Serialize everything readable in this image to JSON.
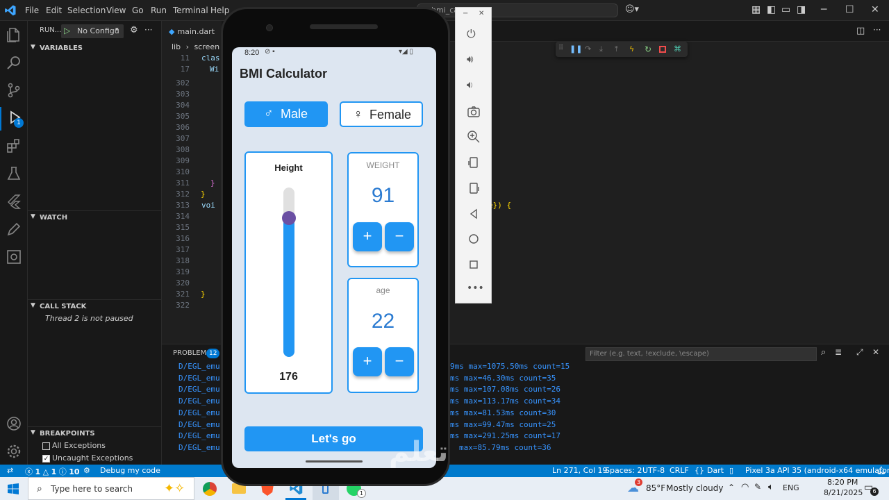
{
  "titlebar": {
    "menus": [
      "File",
      "Edit",
      "Selection",
      "View",
      "Go",
      "Run",
      "Terminal",
      "Help"
    ],
    "search_text": "bmi_ca"
  },
  "sidebar": {
    "run_label": "RUN...",
    "config_label": "No Configu",
    "variables_header": "VARIABLES",
    "watch_header": "WATCH",
    "callstack_header": "CALL STACK",
    "callstack_text": "Thread 2 is not paused",
    "breakpoints_header": "BREAKPOINTS",
    "breakpoints": [
      {
        "label": "All Exceptions",
        "checked": false
      },
      {
        "label": "Uncaught Exceptions",
        "checked": true
      }
    ]
  },
  "editor": {
    "tab_label": "main.dart",
    "breadcrumb": [
      "lib",
      "screen"
    ],
    "lines": [
      {
        "n": "11",
        "code": "clas"
      },
      {
        "n": "17",
        "code": "Wi"
      },
      {
        "n": "302",
        "code": ""
      },
      {
        "n": "303",
        "code": ""
      },
      {
        "n": "304",
        "code": ""
      },
      {
        "n": "305",
        "code": ""
      },
      {
        "n": "306",
        "code": ""
      },
      {
        "n": "307",
        "code": ""
      },
      {
        "n": "308",
        "code": ""
      },
      {
        "n": "309",
        "code": ""
      },
      {
        "n": "310",
        "code": ""
      },
      {
        "n": "311",
        "code": "}"
      },
      {
        "n": "312",
        "code": "}"
      },
      {
        "n": "313",
        "code": "voi"
      },
      {
        "n": "314",
        "code": ""
      },
      {
        "n": "315",
        "code": ""
      },
      {
        "n": "316",
        "code": ""
      },
      {
        "n": "317",
        "code": ""
      },
      {
        "n": "318",
        "code": ""
      },
      {
        "n": "319",
        "code": ""
      },
      {
        "n": "320",
        "code": ""
      },
      {
        "n": "321",
        "code": "}"
      },
      {
        "n": "322",
        "code": ""
      }
    ],
    "right_code": "e}) {"
  },
  "panel": {
    "problems_label": "PROBLEMS",
    "problems_count": "12",
    "filter_placeholder": "Filter (e.g. text, !exclude, \\escape)",
    "log_prefix": "D/EGL_emu",
    "log_lines": [
      "9ms max=1075.50ms count=15",
      "ms max=46.30ms count=35",
      "ms max=107.08ms count=26",
      "ms max=113.17ms count=34",
      "ms max=81.53ms count=30",
      "ms max=99.47ms count=25",
      "ms max=291.25ms count=17",
      "max=85.79ms count=36"
    ]
  },
  "statusbar": {
    "errors": "1",
    "warnings": "1",
    "info": "10",
    "debug_label": "Debug my code",
    "position": "Ln 271, Col 19",
    "spaces": "Spaces: 2",
    "encoding": "UTF-8",
    "eol": "CRLF",
    "language": "Dart",
    "device": "Pixel 3a API 35 (android-x64 emulator)"
  },
  "taskbar": {
    "search_placeholder": "Type here to search",
    "weather_temp": "85°F",
    "weather_text": "Mostly cloudy",
    "lang": "ENG",
    "time": "8:20 PM",
    "date": "8/21/2025",
    "notif_count": "6",
    "weather_badge": "3",
    "whatsapp_badge": "1"
  },
  "phone": {
    "status_time": "8:20",
    "app_title": "BMI Calculator",
    "male_label": "Male",
    "female_label": "Female",
    "height_label": "Height",
    "height_value": "176",
    "height_slider_fraction": 0.18,
    "weight_label": "WEIGHT",
    "weight_value": "91",
    "age_label": "age",
    "age_value": "22",
    "plus": "+",
    "minus": "−",
    "go_label": "Let's go",
    "male_symbol": "♂",
    "female_symbol": "♀",
    "colors": {
      "accent": "#2196f3",
      "background": "#dde6f1",
      "slider_thumb": "#6a4fa3"
    }
  },
  "watermark_text": "تعلم"
}
